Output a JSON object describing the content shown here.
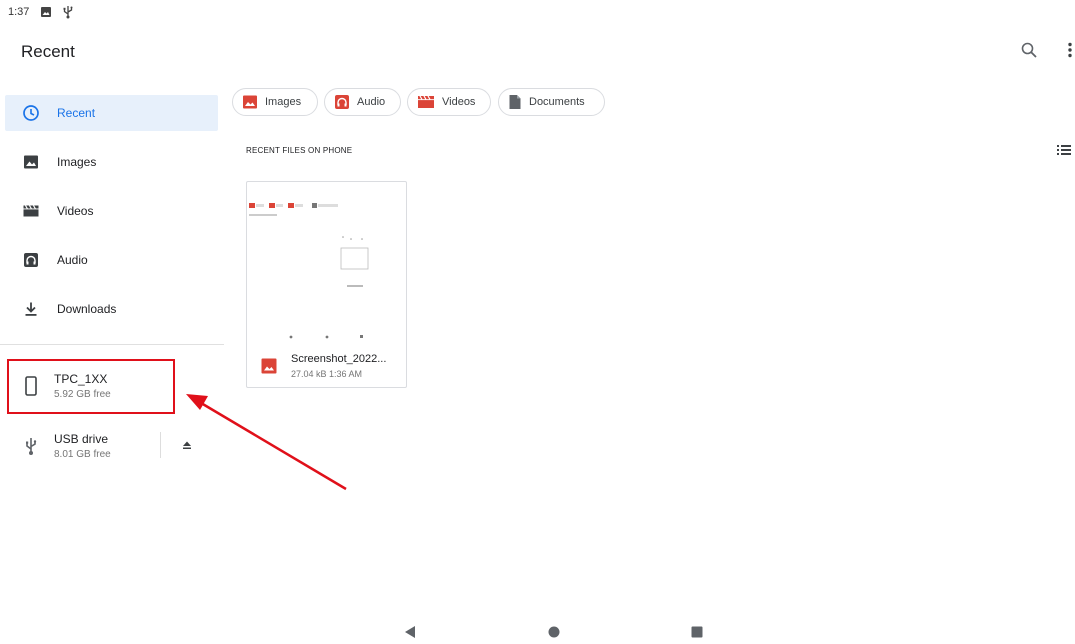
{
  "status_bar": {
    "time": "1:37",
    "icons": [
      "image-icon",
      "usb-icon"
    ]
  },
  "app_bar": {
    "title": "Recent",
    "actions": [
      "search-icon",
      "more-vert-icon"
    ]
  },
  "sidebar": {
    "items": [
      {
        "label": "Recent",
        "icon": "clock-icon",
        "active": true
      },
      {
        "label": "Images",
        "icon": "image-icon"
      },
      {
        "label": "Videos",
        "icon": "movie-icon"
      },
      {
        "label": "Audio",
        "icon": "headphones-icon"
      },
      {
        "label": "Downloads",
        "icon": "download-icon"
      }
    ],
    "roots": [
      {
        "name": "TPC_1XX",
        "free": "5.92 GB free",
        "icon": "phone-icon"
      },
      {
        "name": "USB drive",
        "free": "8.01 GB free",
        "icon": "usb-icon",
        "action": "eject-icon"
      }
    ]
  },
  "chips": [
    {
      "label": "Images",
      "icon": "image-icon"
    },
    {
      "label": "Audio",
      "icon": "headphones-icon"
    },
    {
      "label": "Videos",
      "icon": "movie-icon"
    },
    {
      "label": "Documents",
      "icon": "document-icon"
    }
  ],
  "main": {
    "section_header": "RECENT FILES ON PHONE",
    "view_toggle": "list-view-icon",
    "files": [
      {
        "name": "Screenshot_2022...",
        "meta": "27.04 kB 1:36 AM",
        "icon": "image-icon"
      }
    ]
  },
  "colors": {
    "accent": "#1a73e8",
    "active_bg": "#e7f0fb",
    "chip_icon": "#db4437",
    "annotation": "#e0101a"
  },
  "navbar": [
    "back-icon",
    "home-icon",
    "recents-icon"
  ]
}
